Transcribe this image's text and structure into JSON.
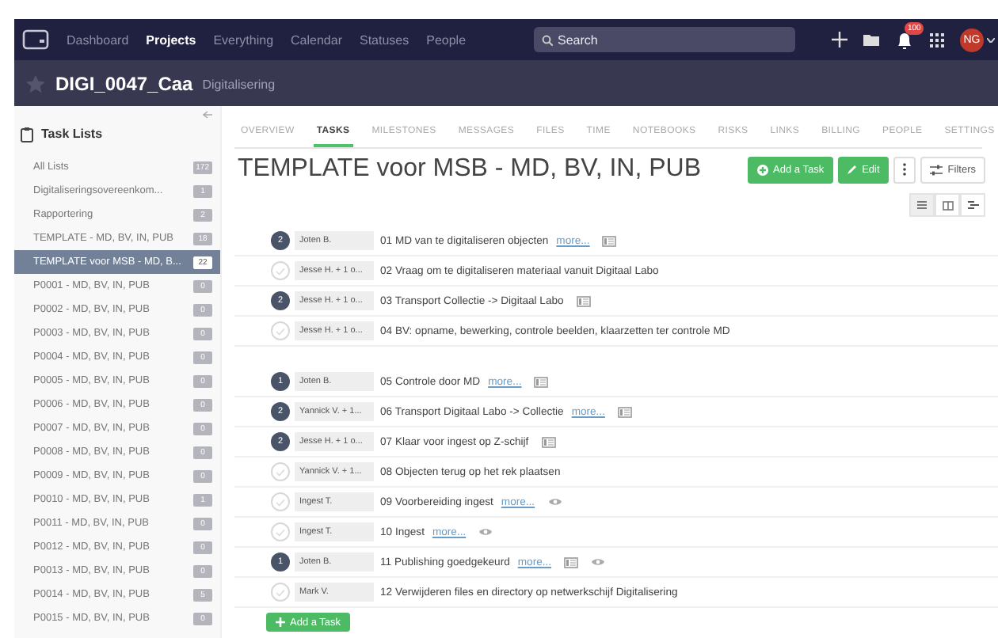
{
  "nav": {
    "items": [
      {
        "label": "Dashboard",
        "selected": false
      },
      {
        "label": "Projects",
        "selected": true
      },
      {
        "label": "Everything",
        "selected": false
      },
      {
        "label": "Calendar",
        "selected": false
      },
      {
        "label": "Statuses",
        "selected": false
      },
      {
        "label": "People",
        "selected": false
      }
    ],
    "search": {
      "placeholder": "Search"
    },
    "notification_badge": "100",
    "avatar": "NG"
  },
  "project": {
    "name": "DIGI_0047_Caa",
    "category": "Digitalisering"
  },
  "sidebar": {
    "title": "Task Lists",
    "items": [
      {
        "label": "All Lists",
        "count": "172",
        "selected": false
      },
      {
        "label": "Digitaliseringsovereenkom...",
        "count": "1",
        "selected": false
      },
      {
        "label": "Rapportering",
        "count": "2",
        "selected": false
      },
      {
        "label": "TEMPLATE - MD, BV, IN, PUB",
        "count": "18",
        "selected": false
      },
      {
        "label": "TEMPLATE voor MSB - MD, B...",
        "count": "22",
        "selected": true
      },
      {
        "label": "P0001 - MD, BV, IN, PUB",
        "count": "0",
        "selected": false
      },
      {
        "label": "P0002 - MD, BV, IN, PUB",
        "count": "0",
        "selected": false
      },
      {
        "label": "P0003 - MD, BV, IN, PUB",
        "count": "0",
        "selected": false
      },
      {
        "label": "P0004 - MD, BV, IN, PUB",
        "count": "0",
        "selected": false
      },
      {
        "label": "P0005 - MD, BV, IN, PUB",
        "count": "0",
        "selected": false
      },
      {
        "label": "P0006 - MD, BV, IN, PUB",
        "count": "0",
        "selected": false
      },
      {
        "label": "P0007 - MD, BV, IN, PUB",
        "count": "0",
        "selected": false
      },
      {
        "label": "P0008 - MD, BV, IN, PUB",
        "count": "0",
        "selected": false
      },
      {
        "label": "P0009 - MD, BV, IN, PUB",
        "count": "0",
        "selected": false
      },
      {
        "label": "P0010 - MD, BV, IN, PUB",
        "count": "1",
        "selected": false
      },
      {
        "label": "P0011 - MD, BV, IN, PUB",
        "count": "0",
        "selected": false
      },
      {
        "label": "P0012 - MD, BV, IN, PUB",
        "count": "0",
        "selected": false
      },
      {
        "label": "P0013 - MD, BV, IN, PUB",
        "count": "0",
        "selected": false
      },
      {
        "label": "P0014 - MD, BV, IN, PUB",
        "count": "5",
        "selected": false
      },
      {
        "label": "P0015 - MD, BV, IN, PUB",
        "count": "0",
        "selected": false
      }
    ]
  },
  "tabs": [
    {
      "label": "OVERVIEW",
      "selected": false
    },
    {
      "label": "TASKS",
      "selected": true
    },
    {
      "label": "MILESTONES",
      "selected": false
    },
    {
      "label": "MESSAGES",
      "selected": false
    },
    {
      "label": "FILES",
      "selected": false
    },
    {
      "label": "TIME",
      "selected": false
    },
    {
      "label": "NOTEBOOKS",
      "selected": false
    },
    {
      "label": "RISKS",
      "selected": false
    },
    {
      "label": "LINKS",
      "selected": false
    },
    {
      "label": "BILLING",
      "selected": false
    },
    {
      "label": "PEOPLE",
      "selected": false
    },
    {
      "label": "SETTINGS",
      "selected": false
    }
  ],
  "list_title": "TEMPLATE voor MSB - MD, BV, IN, PUB",
  "buttons": {
    "add_task": "Add a Task",
    "edit": "Edit",
    "filters": "Filters"
  },
  "task_groups": [
    {
      "tasks": [
        {
          "kind": "count",
          "count": "2",
          "assignee": "Joten B.",
          "title": "01 MD van te digitaliseren objecten",
          "more": "more...",
          "note": true,
          "watched": false
        },
        {
          "kind": "check",
          "checked": false,
          "assignee": "Jesse H. + 1 o...",
          "title": "02 Vraag om te digitaliseren materiaal vanuit Digitaal Labo",
          "note": false,
          "watched": false
        },
        {
          "kind": "count",
          "count": "2",
          "assignee": "Jesse H. + 1 o...",
          "title": "03 Transport Collectie -> Digitaal Labo",
          "note": true,
          "watched": false
        },
        {
          "kind": "check",
          "checked": false,
          "assignee": "Jesse H. + 1 o...",
          "title": "04 BV: opname, bewerking, controle beelden, klaarzetten ter controle MD",
          "note": false,
          "watched": false
        }
      ]
    },
    {
      "tasks": [
        {
          "kind": "count",
          "count": "1",
          "assignee": "Joten B.",
          "title": "05 Controle door MD",
          "more": "more...",
          "note": true,
          "watched": false
        },
        {
          "kind": "count",
          "count": "2",
          "assignee": "Yannick V. + 1...",
          "title": "06 Transport Digitaal Labo -> Collectie",
          "more": "more...",
          "note": true,
          "watched": false
        },
        {
          "kind": "count",
          "count": "2",
          "assignee": "Jesse H. + 1 o...",
          "title": "07 Klaar voor ingest op Z-schijf",
          "note": true,
          "watched": false
        },
        {
          "kind": "check",
          "checked": false,
          "assignee": "Yannick V. + 1...",
          "title": "08 Objecten terug op het rek plaatsen",
          "note": false,
          "watched": false
        },
        {
          "kind": "check",
          "checked": false,
          "assignee": "Ingest T.",
          "title": "09 Voorbereiding ingest",
          "more": "more...",
          "note": false,
          "watched": true
        },
        {
          "kind": "check",
          "checked": false,
          "assignee": "Ingest T.",
          "title": "10 Ingest",
          "more": "more...",
          "note": false,
          "watched": true
        },
        {
          "kind": "count",
          "count": "1",
          "assignee": "Joten B.",
          "title": "11 Publishing goedgekeurd",
          "more": "more...",
          "note": true,
          "watched": true
        },
        {
          "kind": "check",
          "checked": false,
          "assignee": "Mark V.",
          "title": "12 Verwijderen files en directory op netwerkschijf Digitalisering",
          "note": false,
          "watched": false
        }
      ]
    }
  ],
  "bottom_button": "Add a Task"
}
